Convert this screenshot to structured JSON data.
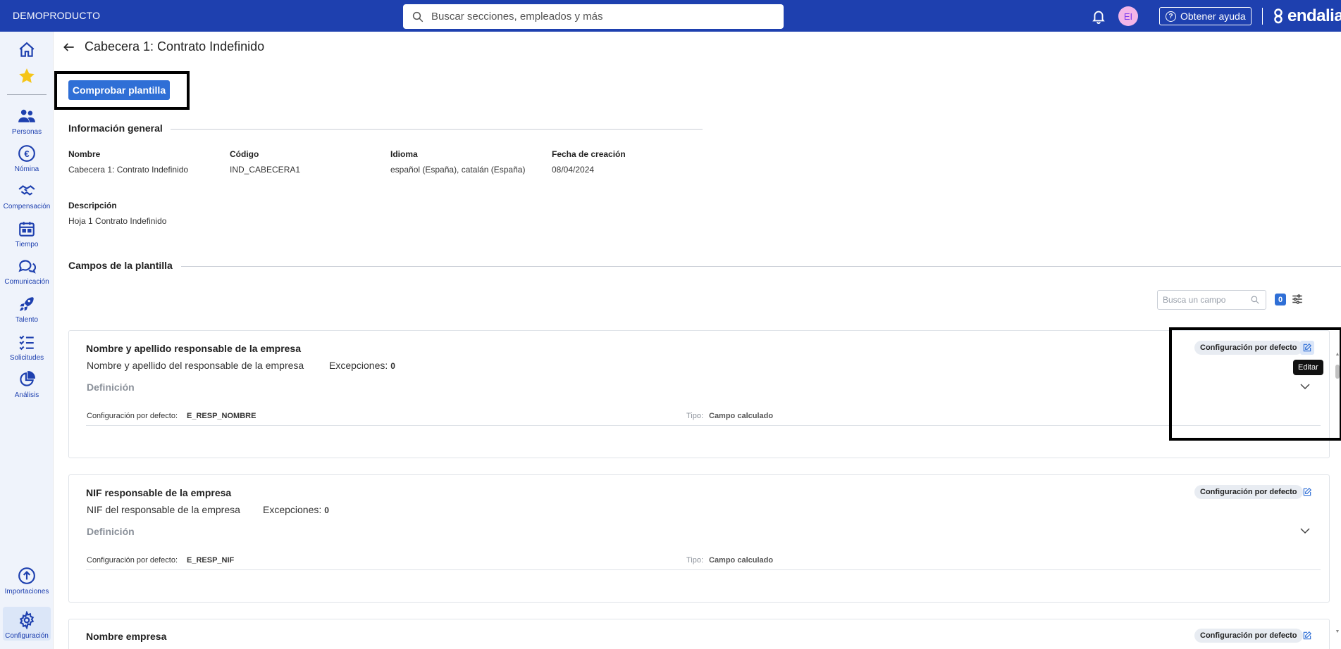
{
  "topbar": {
    "company": "DEMOPRODUCTO",
    "search_placeholder": "Buscar secciones, empleados y más",
    "avatar_initials": "EI",
    "help_label": "Obtener ayuda",
    "logo_text": "endalia",
    "bar_color": "#1e40af"
  },
  "sidebar": {
    "items": [
      {
        "label": "",
        "icon": "home-icon"
      },
      {
        "label": "",
        "icon": "star-icon"
      },
      {
        "label": "Personas",
        "icon": "people-icon"
      },
      {
        "label": "Nómina",
        "icon": "euro-icon"
      },
      {
        "label": "Compensación",
        "icon": "handshake-icon"
      },
      {
        "label": "Tiempo",
        "icon": "calendar-icon"
      },
      {
        "label": "Comunicación",
        "icon": "chat-icon"
      },
      {
        "label": "Talento",
        "icon": "rocket-icon"
      },
      {
        "label": "Solicitudes",
        "icon": "checklist-icon"
      },
      {
        "label": "Análisis",
        "icon": "pie-chart-icon"
      },
      {
        "label": "Importaciones",
        "icon": "upload-icon"
      },
      {
        "label": "Configuración",
        "icon": "gear-icon"
      }
    ]
  },
  "page": {
    "title": "Cabecera 1: Contrato Indefinido",
    "check_button": "Comprobar plantilla"
  },
  "general_info": {
    "section_title": "Información general",
    "name_label": "Nombre",
    "name_value": "Cabecera 1: Contrato Indefinido",
    "code_label": "Código",
    "code_value": "IND_CABECERA1",
    "language_label": "Idioma",
    "language_value": "español (España), catalán (España)",
    "date_label": "Fecha de creación",
    "date_value": "08/04/2024",
    "description_label": "Descripción",
    "description_value": "Hoja 1 Contrato Indefinido"
  },
  "fields": {
    "section_title": "Campos de la plantilla",
    "search_placeholder": "Busca un campo",
    "filter_count": "0",
    "items": [
      {
        "title": "Nombre y apellido responsable de la empresa",
        "description": "Nombre y apellido del responsable de la empresa",
        "exceptions_label": "Excepciones:",
        "exceptions_value": "0",
        "definition_label": "Definición",
        "config_label": "Configuración por defecto:",
        "config_value": "E_RESP_NOMBRE",
        "type_label": "Tipo:",
        "type_value": "Campo calculado",
        "chip": "Configuración por defecto",
        "edit_tooltip": "Editar"
      },
      {
        "title": "NIF responsable de la empresa",
        "description": "NIF del responsable de la empresa",
        "exceptions_label": "Excepciones:",
        "exceptions_value": "0",
        "definition_label": "Definición",
        "config_label": "Configuración por defecto:",
        "config_value": "E_RESP_NIF",
        "type_label": "Tipo:",
        "type_value": "Campo calculado",
        "chip": "Configuración por defecto"
      },
      {
        "title": "Nombre empresa",
        "chip": "Configuración por defecto"
      }
    ]
  }
}
